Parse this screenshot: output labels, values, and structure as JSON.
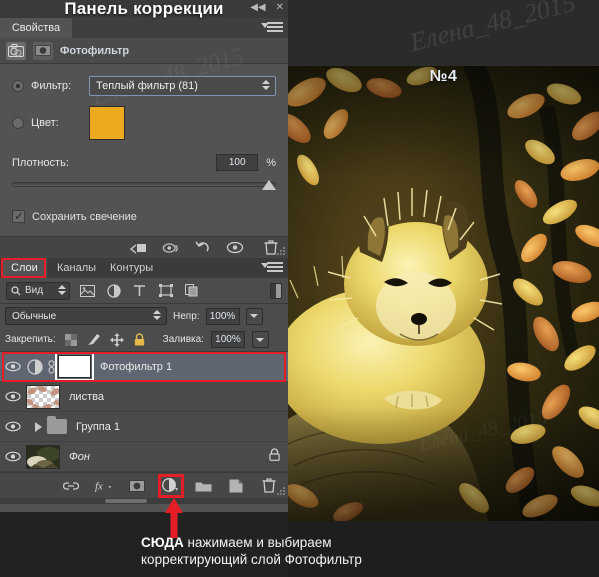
{
  "window": {
    "collapse_icon": "collapse-left-icon",
    "close_icon": "close-icon"
  },
  "properties_panel": {
    "overlay_title": "Панель коррекции",
    "tabs": [
      {
        "label": "Свойства",
        "active": true
      }
    ],
    "menu_icon": "panel-menu-icon",
    "adjustment_header": {
      "icon": "photo-filter-icon",
      "mask_icon": "mask-icon",
      "label": "Фотофильтр"
    },
    "filter_radio": {
      "label": "Фильтр:",
      "selected": true
    },
    "filter_select": {
      "value": "Теплый фильтр (81)"
    },
    "color_radio": {
      "label": "Цвет:",
      "selected": false
    },
    "color_swatch": {
      "hex": "#eeaa1e"
    },
    "density": {
      "label": "Плотность:",
      "value": "100",
      "unit": "%",
      "slider_percent": 100
    },
    "preserve_luminosity": {
      "label": "Сохранить свечение",
      "checked": true
    },
    "footer_buttons": [
      {
        "name": "clip-to-layer-icon"
      },
      {
        "name": "toggle-visibility-icon"
      },
      {
        "name": "reset-icon"
      },
      {
        "name": "eye-icon"
      },
      {
        "name": "trash-icon"
      }
    ]
  },
  "layers_panel": {
    "tabs": [
      {
        "label": "Слои",
        "active": true,
        "highlighted": true
      },
      {
        "label": "Каналы",
        "active": false,
        "highlighted": false
      },
      {
        "label": "Контуры",
        "active": false,
        "highlighted": false
      }
    ],
    "menu_icon": "panel-menu-icon",
    "filter_row": {
      "search_icon": "search-icon",
      "kind_value": "Вид",
      "icons": [
        "pixel-layer-filter-icon",
        "adjustment-filter-icon",
        "type-filter-icon",
        "shape-filter-icon",
        "smart-object-filter-icon"
      ],
      "toggle_name": "filter-enable-toggle"
    },
    "blend_row": {
      "blend_mode": "Обычные",
      "opacity_label": "Непр:",
      "opacity_value": "100%"
    },
    "lock_row": {
      "lock_label": "Закрепить:",
      "lock_icons": [
        "lock-transparency-icon",
        "lock-image-icon",
        "lock-position-icon",
        "lock-all-icon"
      ],
      "fill_label": "Заливка:",
      "fill_value": "100%"
    },
    "layers": [
      {
        "name": "Фотофильтр 1",
        "visible": true,
        "selected": true,
        "highlighted": true,
        "type": "adjustment",
        "has_mask": true,
        "linked": true,
        "locked": false,
        "italic": false
      },
      {
        "name": "листва",
        "visible": true,
        "selected": false,
        "highlighted": false,
        "type": "pixel",
        "has_mask": false,
        "linked": false,
        "locked": false,
        "italic": false
      },
      {
        "name": "Группа 1",
        "visible": true,
        "selected": false,
        "highlighted": false,
        "type": "group",
        "has_mask": false,
        "linked": false,
        "locked": false,
        "italic": false
      },
      {
        "name": "Фон",
        "visible": true,
        "selected": false,
        "highlighted": false,
        "type": "background",
        "has_mask": false,
        "linked": false,
        "locked": true,
        "italic": true
      }
    ],
    "footer_buttons": [
      {
        "name": "link-layers-icon",
        "highlighted": false
      },
      {
        "name": "layer-style-fx-icon",
        "highlighted": false
      },
      {
        "name": "add-layer-mask-icon",
        "highlighted": false
      },
      {
        "name": "new-adjustment-layer-icon",
        "highlighted": true
      },
      {
        "name": "new-group-icon",
        "highlighted": false
      },
      {
        "name": "new-layer-icon",
        "highlighted": false
      },
      {
        "name": "delete-layer-icon",
        "highlighted": false
      }
    ]
  },
  "canvas": {
    "badge": "№4"
  },
  "annotation": {
    "arrow": "red-up-arrow",
    "line1_strong": "СЮДА",
    "line1_rest": " нажимаем и выбираем",
    "line2": "корректирующий слой Фотофильтр"
  },
  "watermarks": [
    "Елена_48_2015",
    "Елена_48_2015",
    "Елена_48_2015"
  ],
  "colors": {
    "accent_red": "#e41e26",
    "panel_bg": "#535353",
    "panel_dark": "#3b3b3b",
    "selection_blue": "#5f6672",
    "swatch": "#eeaa1e"
  }
}
